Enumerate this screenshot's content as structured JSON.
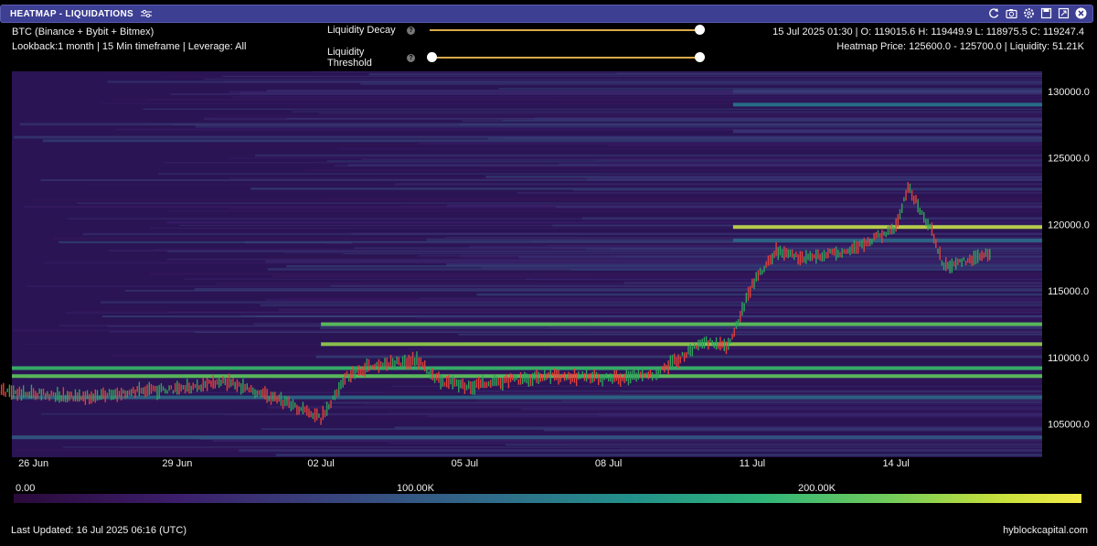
{
  "window": {
    "title": "HEATMAP - LIQUIDATIONS",
    "icons": [
      "refresh-icon",
      "camera-icon",
      "settings-icon",
      "save-icon",
      "expand-icon",
      "close-icon"
    ]
  },
  "info": {
    "line1": "BTC (Binance + Bybit + Bitmex)",
    "line2": "Lookback:1 month | 15 Min timeframe | Leverage: All"
  },
  "controls": {
    "decay_label": "Liquidity Decay",
    "threshold_label": "Liquidity Threshold",
    "decay_value": 1.0,
    "threshold_range": [
      0.0,
      1.0
    ]
  },
  "readout": {
    "ohlc": "15 Jul 2025 01:30 | O: 119015.6 H: 119449.9 L: 118975.5 C: 119247.4",
    "heatmap": "Heatmap Price: 125600.0 - 125700.0 | Liquidity: 51.21K"
  },
  "colors": {
    "title_bar": "#3d3f93",
    "candle_up": "#2fa35a",
    "candle_down": "#e0413a",
    "heat_low": "#2a0a3a",
    "heat_high": "#f4ec4a"
  },
  "chart_data": {
    "type": "heatmap",
    "x_ticks": [
      "26 Jun",
      "29 Jun",
      "02 Jul",
      "05 Jul",
      "08 Jul",
      "11 Jul",
      "14 Jul"
    ],
    "y_ticks": [
      "130000.0",
      "125000.0",
      "120000.0",
      "115000.0",
      "110000.0",
      "105000.0"
    ],
    "ylim": [
      102500,
      131500
    ],
    "price_path": [
      {
        "x": "25 Jun",
        "y": 107500
      },
      {
        "x": "26 Jun",
        "y": 107300
      },
      {
        "x": "27 Jun",
        "y": 107000
      },
      {
        "x": "28 Jun",
        "y": 107400
      },
      {
        "x": "29 Jun",
        "y": 107600
      },
      {
        "x": "30 Jun",
        "y": 108200
      },
      {
        "x": "01 Jul",
        "y": 107000
      },
      {
        "x": "02 Jul",
        "y": 105400
      },
      {
        "x": "02 Jul 12h",
        "y": 108500
      },
      {
        "x": "03 Jul",
        "y": 109300
      },
      {
        "x": "04 Jul",
        "y": 109800
      },
      {
        "x": "04 Jul 12h",
        "y": 108200
      },
      {
        "x": "05 Jul",
        "y": 107800
      },
      {
        "x": "06 Jul",
        "y": 108300
      },
      {
        "x": "07 Jul",
        "y": 108600
      },
      {
        "x": "08 Jul",
        "y": 108400
      },
      {
        "x": "09 Jul",
        "y": 108800
      },
      {
        "x": "10 Jul",
        "y": 111200
      },
      {
        "x": "10 Jul 12h",
        "y": 110900
      },
      {
        "x": "11 Jul",
        "y": 115500
      },
      {
        "x": "11 Jul 12h",
        "y": 118000
      },
      {
        "x": "12 Jul",
        "y": 117500
      },
      {
        "x": "13 Jul",
        "y": 118000
      },
      {
        "x": "14 Jul",
        "y": 119800
      },
      {
        "x": "14 Jul 06h",
        "y": 122800
      },
      {
        "x": "14 Jul 18h",
        "y": 119500
      },
      {
        "x": "15 Jul",
        "y": 116800
      },
      {
        "x": "15 Jul 12h",
        "y": 117300
      },
      {
        "x": "16 Jul",
        "y": 117800
      }
    ],
    "liquidity_bands": [
      {
        "price": 130000,
        "intensity": 0.35
      },
      {
        "price": 129000,
        "intensity": 0.55
      },
      {
        "price": 127000,
        "intensity": 0.3
      },
      {
        "price": 119800,
        "intensity": 0.95
      },
      {
        "price": 118800,
        "intensity": 0.5
      },
      {
        "price": 112500,
        "intensity": 0.85
      },
      {
        "price": 111000,
        "intensity": 0.9
      },
      {
        "price": 109200,
        "intensity": 0.8
      },
      {
        "price": 108600,
        "intensity": 0.85
      },
      {
        "price": 107000,
        "intensity": 0.5
      },
      {
        "price": 104000,
        "intensity": 0.45
      }
    ]
  },
  "colorbar": {
    "labels": [
      "0.00",
      "100.00K",
      "200.00K"
    ]
  },
  "footer": {
    "updated": "Last Updated: 16 Jul 2025 06:16 (UTC)",
    "brand": "hyblockcapital.com"
  }
}
